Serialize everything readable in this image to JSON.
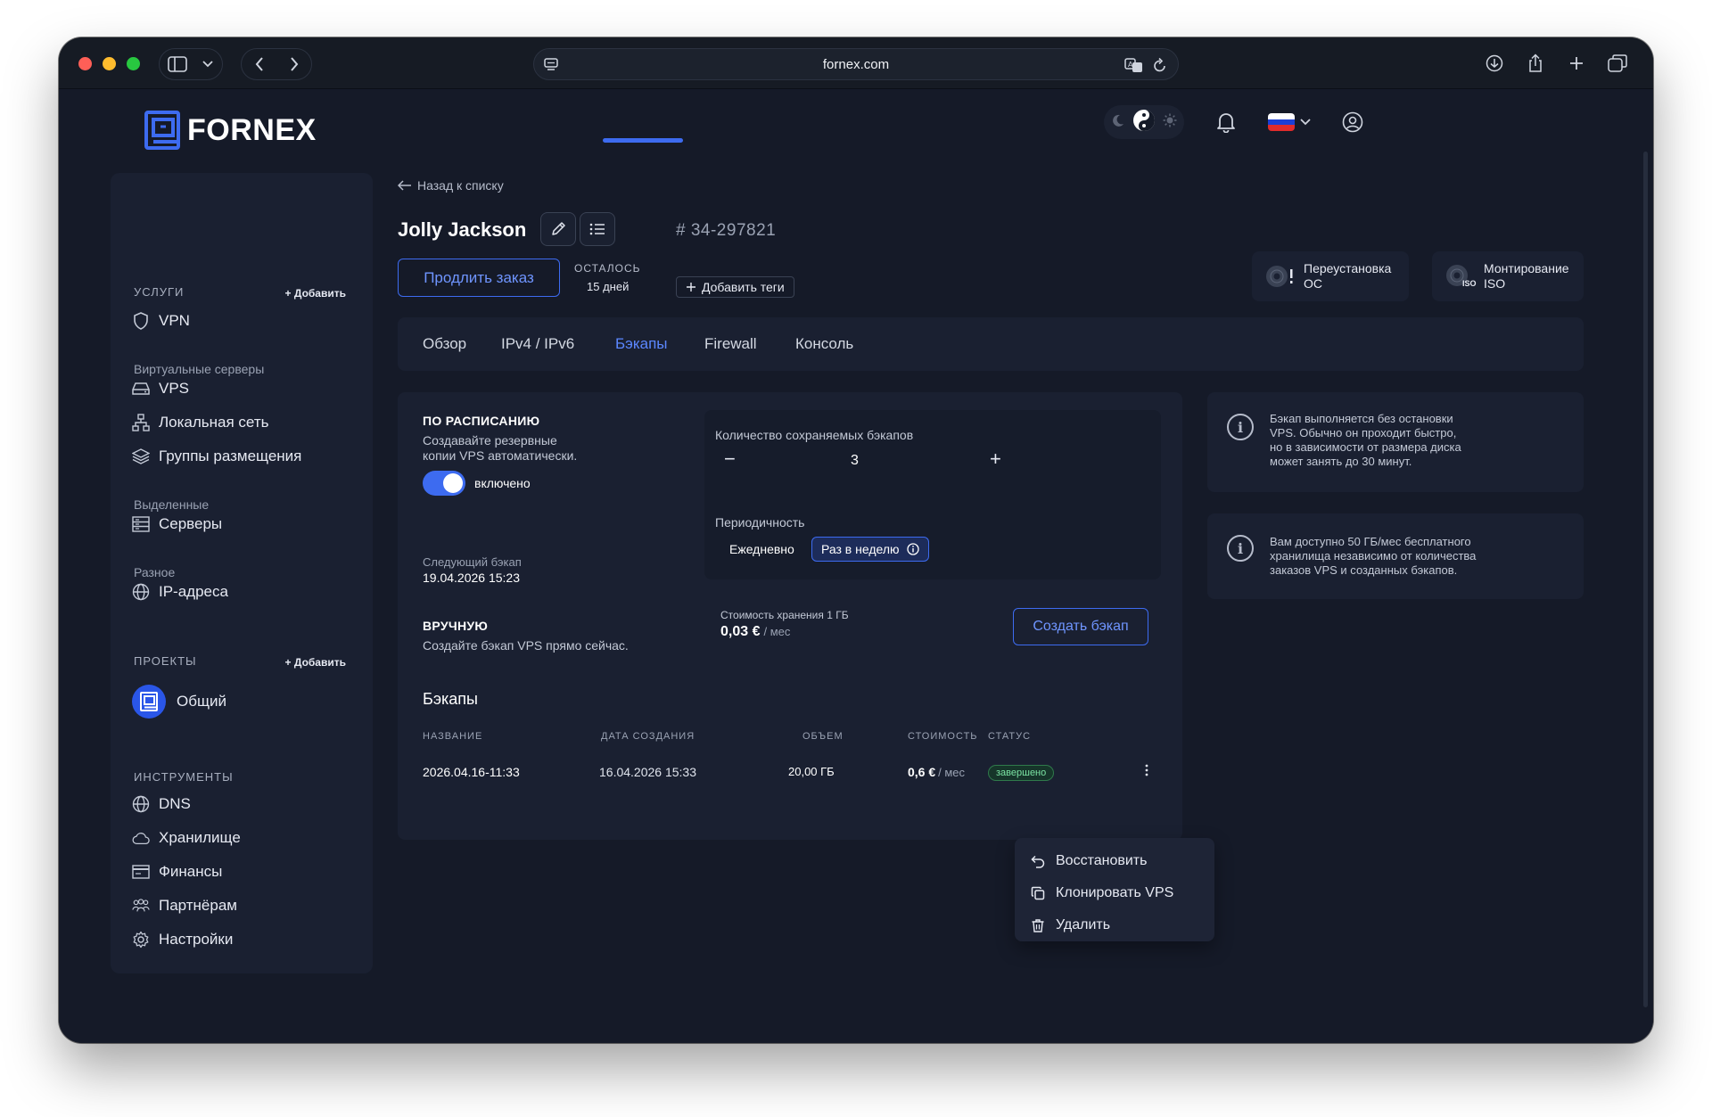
{
  "browser": {
    "url": "fornex.com"
  },
  "logo": {
    "text": "FORNEX"
  },
  "sidebar": {
    "services_title": "УСЛУГИ",
    "services_add": "+ Добавить",
    "vpn": "VPN",
    "virtual_servers_title": "Виртуальные серверы",
    "vps": "VPS",
    "local_network": "Локальная сеть",
    "placement_groups": "Группы размещения",
    "dedicated_title": "Выделенные",
    "servers": "Серверы",
    "misc_title": "Разное",
    "ip_addresses": "IP-адреса",
    "projects_title": "ПРОЕКТЫ",
    "projects_add": "+ Добавить",
    "project_general": "Общий",
    "tools_title": "ИНСТРУМЕНТЫ",
    "dns": "DNS",
    "storage": "Хранилище",
    "finance": "Финансы",
    "partners": "Партнёрам",
    "settings": "Настройки"
  },
  "header": {
    "back_link": "Назад к списку",
    "server_name": "Jolly Jackson",
    "order_id": "# 34-297821",
    "extend_order": "Продлить заказ",
    "remaining_label": "ОСТАЛОСЬ",
    "remaining_value": "15 дней",
    "add_tags": "Добавить теги",
    "reinstall_os": [
      "Переустановка",
      "ОС"
    ],
    "mount_iso": [
      "Монтирование",
      "ISO"
    ],
    "iso_badge": "ISO"
  },
  "tabs": [
    {
      "label": "Обзор"
    },
    {
      "label": "IPv4 / IPv6"
    },
    {
      "label": "Бэкапы",
      "active": true
    },
    {
      "label": "Firewall"
    },
    {
      "label": "Консоль"
    }
  ],
  "backups": {
    "schedule_title": "ПО РАСПИСАНИЮ",
    "schedule_desc": [
      "Создавайте резервные",
      "копии VPS автоматически."
    ],
    "toggle_label": "включено",
    "next_backup_label": "Следующий бэкап",
    "next_backup_value": "19.04.2026 15:23",
    "keep_count_label": "Количество сохраняемых бэкапов",
    "keep_count_value": "3",
    "minus": "−",
    "plus": "+",
    "period_label": "Периодичность",
    "period_daily": "Ежедневно",
    "period_weekly": "Раз в неделю",
    "manual_title": "ВРУЧНУЮ",
    "manual_desc": "Создайте бэкап VPS прямо сейчас.",
    "storage_cost_label": "Стоимость хранения 1 ГБ",
    "storage_cost_value": "0,03 €",
    "storage_cost_unit": "/ мес",
    "create_button": "Создать бэкап",
    "list_title": "Бэкапы",
    "columns": {
      "name": "НАЗВАНИЕ",
      "created": "ДАТА СОЗДАНИЯ",
      "size": "ОБЪЕМ",
      "cost": "СТОИМОСТЬ",
      "status": "СТАТУС"
    },
    "rows": [
      {
        "name": "2026.04.16-11:33",
        "created": "16.04.2026 15:33",
        "size": "20,00 ГБ",
        "cost": "0,6 €",
        "cost_unit": "/ мес",
        "status": "завершено"
      }
    ]
  },
  "context_menu": {
    "restore": "Восстановить",
    "clone": "Клонировать VPS",
    "delete": "Удалить"
  },
  "info": {
    "card1": [
      "Бэкап выполняется без остановки",
      "VPS. Обычно он проходит быстро,",
      "но в зависимости от размера диска",
      "может занять до 30 минут."
    ],
    "card2": [
      "Вам доступно 50 ГБ/мес бесплатного",
      "хранилища независимо от количества",
      "заказов VPS и созданных бэкапов."
    ]
  },
  "colors": {
    "accent": "#3d6bf0",
    "background": "#151a28",
    "card": "#1a2031",
    "success": "#7be3a3"
  }
}
